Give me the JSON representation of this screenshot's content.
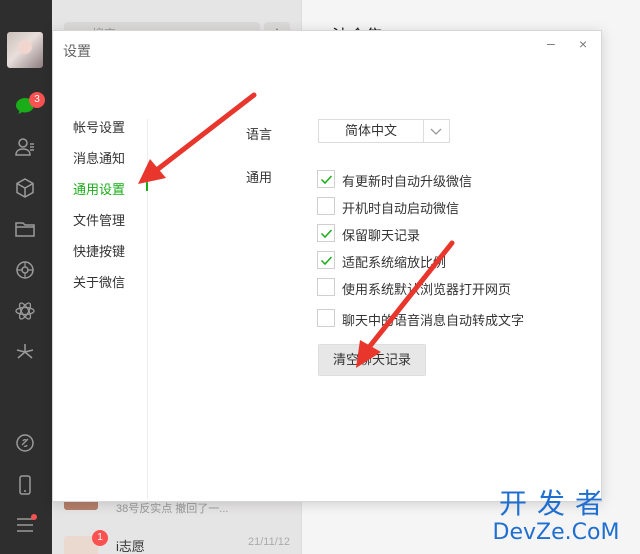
{
  "dialog": {
    "title": "设置",
    "minimize_glyph": "–",
    "close_glyph": "×"
  },
  "nav": {
    "items": [
      {
        "label": "帐号设置",
        "active": false
      },
      {
        "label": "消息通知",
        "active": false
      },
      {
        "label": "通用设置",
        "active": true
      },
      {
        "label": "文件管理",
        "active": false
      },
      {
        "label": "快捷按键",
        "active": false
      },
      {
        "label": "关于微信",
        "active": false
      }
    ]
  },
  "language": {
    "label": "语言",
    "value": "简体中文"
  },
  "general": {
    "label": "通用",
    "options": [
      {
        "label": "有更新时自动升级微信",
        "checked": true
      },
      {
        "label": "开机时自动启动微信",
        "checked": false
      },
      {
        "label": "保留聊天记录",
        "checked": true
      },
      {
        "label": "适配系统缩放比例",
        "checked": true
      },
      {
        "label": "使用系统默认浏览器打开网页",
        "checked": false
      },
      {
        "label": "聊天中的语音消息自动转成文字",
        "checked": false
      }
    ],
    "clear_button": "清空聊天记录"
  },
  "sidebar": {
    "unread_badge": "3"
  },
  "chat_list": {
    "search_placeholder": "搜索",
    "add_button": "+",
    "items": [
      {
        "preview": "38号反实点 撤回了一..."
      },
      {
        "name": "i志愿",
        "time": "21/11/12",
        "badge": "1"
      }
    ]
  },
  "main": {
    "title": "法令集"
  },
  "watermark": {
    "cn": "开发者",
    "en": "DevZe.CoM"
  },
  "colors": {
    "accent": "#1aad19",
    "arrow": "#e8362c",
    "badge": "#fa5151",
    "sidebar": "#2e2e2e"
  }
}
